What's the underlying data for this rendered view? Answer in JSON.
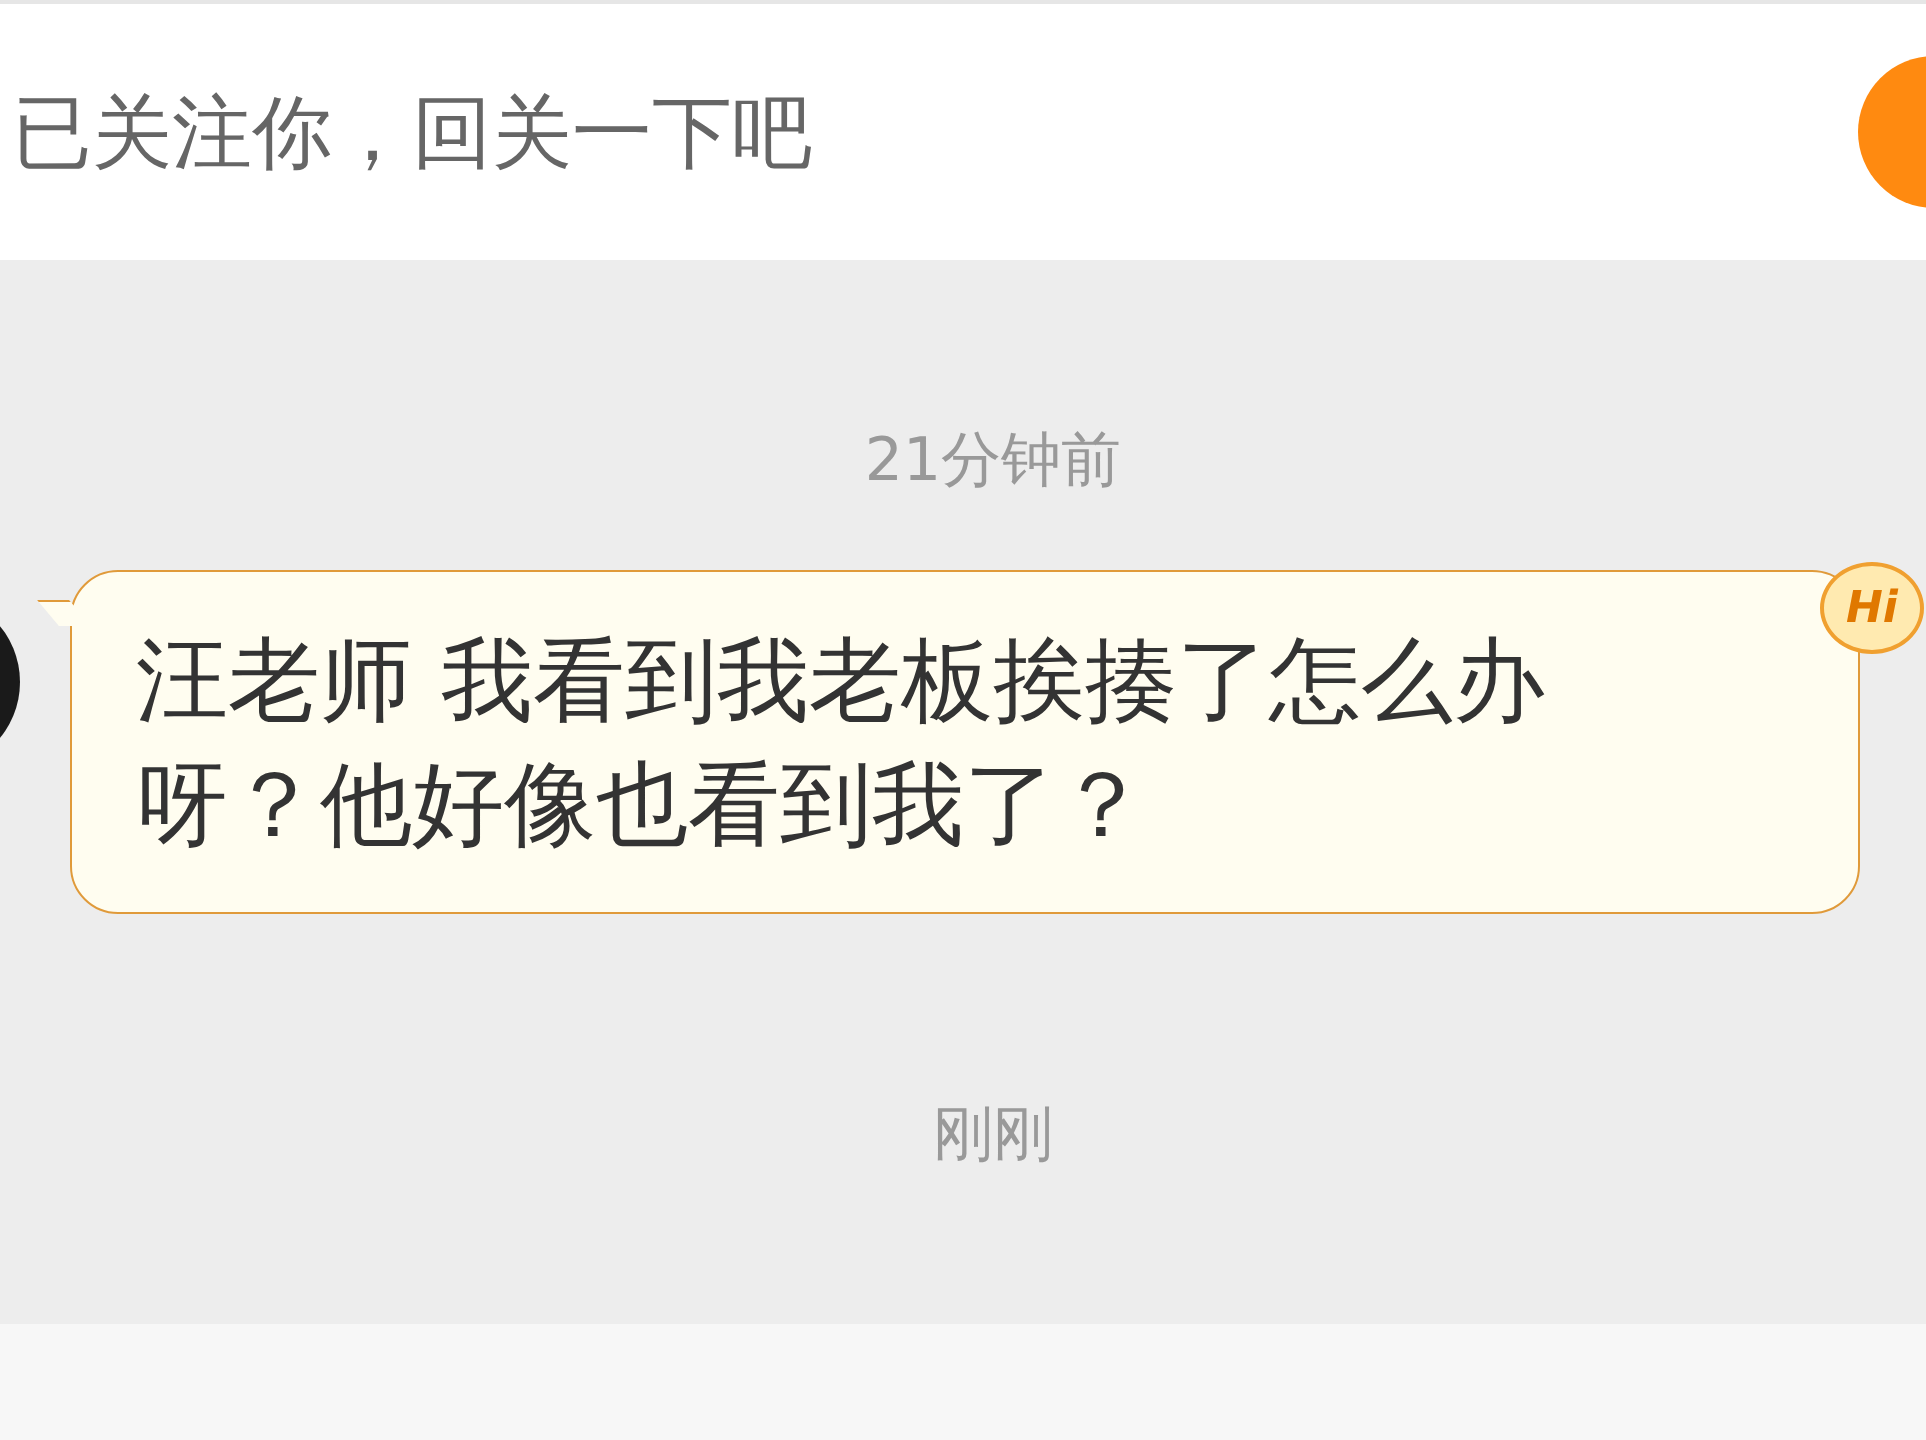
{
  "notice": {
    "text": "已关注你，回关一下吧"
  },
  "messages": [
    {
      "kind": "time",
      "text": "21分钟前"
    },
    {
      "kind": "bubble",
      "text": "汪老师 我看到我老板挨揍了怎么办呀？他好像也看到我了？",
      "badge": "Hi"
    },
    {
      "kind": "time",
      "text": "刚刚"
    }
  ]
}
